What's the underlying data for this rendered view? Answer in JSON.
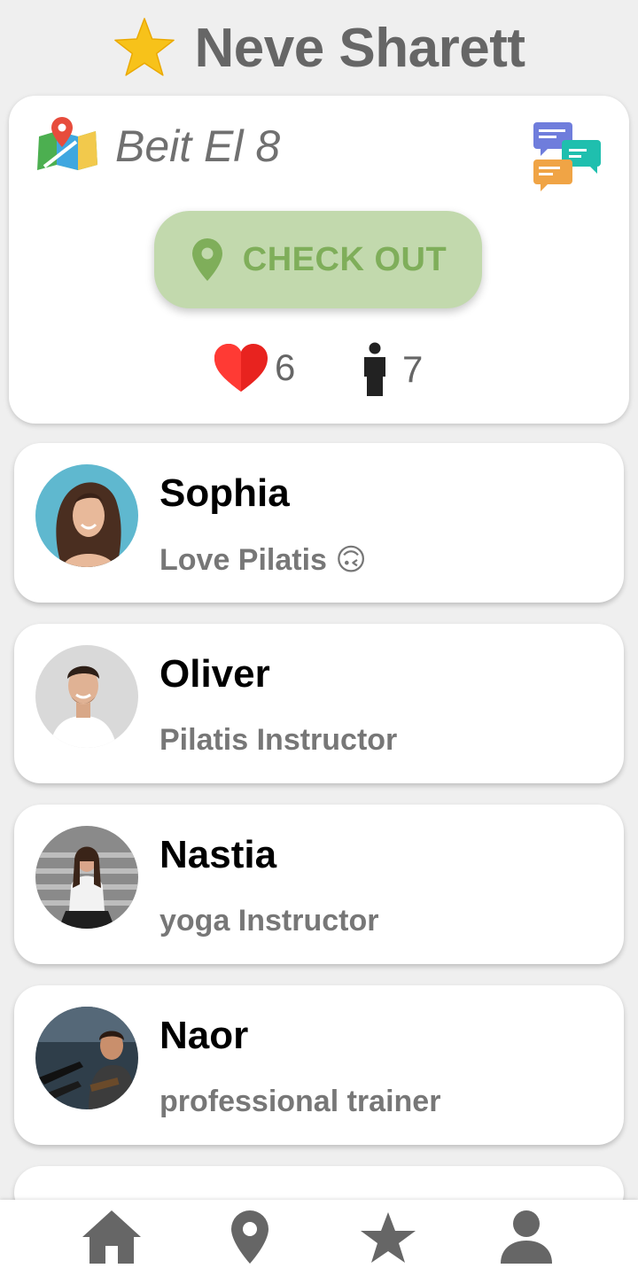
{
  "header": {
    "title": "Neve Sharett",
    "icon": "star-icon"
  },
  "location": {
    "address": "Beit El 8",
    "map_icon": "map-pin-icon",
    "chat_icon": "chat-bubbles-icon",
    "checkout_label": "CHECK OUT",
    "likes_count": "6",
    "people_count": "7"
  },
  "people": [
    {
      "name": "Sophia",
      "bio": "Love Pilatis 🙃"
    },
    {
      "name": "Oliver",
      "bio": "Pilatis Instructor"
    },
    {
      "name": "Nastia",
      "bio": "yoga Instructor"
    },
    {
      "name": "Naor",
      "bio": "professional trainer"
    }
  ],
  "nav": {
    "items": [
      "home-icon",
      "location-pin-icon",
      "star-icon",
      "profile-icon"
    ]
  },
  "colors": {
    "checkout_bg": "#c2d9ad",
    "checkout_text": "#7fae5a",
    "heart": "#e8231f",
    "nav_icon": "#666666"
  }
}
